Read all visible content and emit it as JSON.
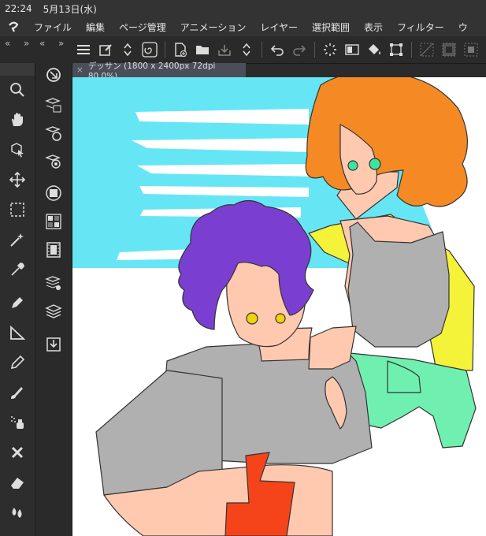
{
  "status": {
    "time": "22:24",
    "date": "5月13日(水)"
  },
  "menu": [
    "ファイル",
    "編集",
    "ページ管理",
    "アニメーション",
    "レイヤー",
    "選択範囲",
    "表示",
    "フィルター",
    "ウ"
  ],
  "document_tab": {
    "label": "デッサン (1800 x 2400px 72dpi 80.0%)"
  },
  "collapse_left": "«",
  "collapse_right": "»",
  "colors": {
    "sky": "#66e6f5",
    "hair_left": "#7a3fd1",
    "hair_right": "#f58a25",
    "jacket": "#f5f23a",
    "shirt": "#b0b0b0",
    "shorts": "#6ff0b0",
    "device": "#f5441a"
  }
}
